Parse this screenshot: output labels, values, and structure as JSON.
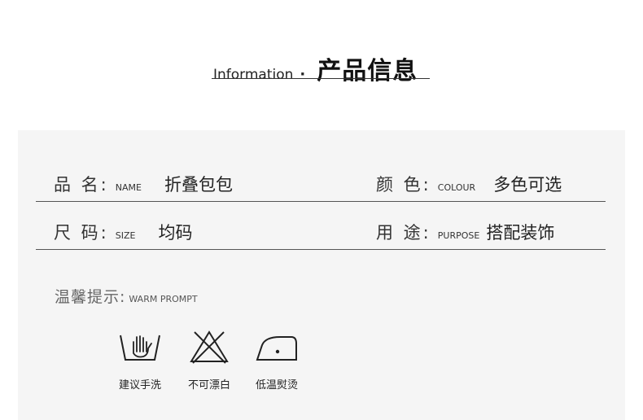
{
  "header": {
    "title_en": "Information",
    "dot": "·",
    "title_cn": "产品信息"
  },
  "info_rows": [
    {
      "left": {
        "label_cn": "品 名:",
        "label_en": "NAME",
        "value": "折叠包包"
      },
      "right": {
        "label_cn": "颜 色:",
        "label_en": "COLOUR",
        "value": "多色可选"
      }
    },
    {
      "left": {
        "label_cn": "尺 码:",
        "label_en": "SIZE",
        "value": "均码"
      },
      "right": {
        "label_cn": "用 途:",
        "label_en": "PURPOSE",
        "value": "搭配装饰"
      }
    }
  ],
  "prompt": {
    "label_cn": "温馨提示:",
    "label_en": "WARM PROMPT"
  },
  "care_items": [
    {
      "icon": "hand-wash-icon",
      "label": "建议手洗"
    },
    {
      "icon": "no-bleach-icon",
      "label": "不可漂白"
    },
    {
      "icon": "low-iron-icon",
      "label": "低温熨烫"
    }
  ]
}
